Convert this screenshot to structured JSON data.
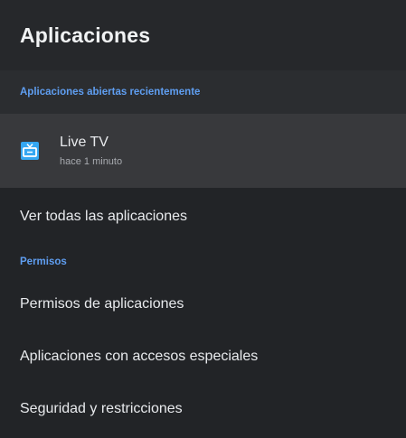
{
  "header": {
    "title": "Aplicaciones"
  },
  "recent_section": {
    "title": "Aplicaciones abiertas recientemente",
    "apps": [
      {
        "name": "Live TV",
        "time": "hace 1 minuto",
        "icon": "tv-icon"
      }
    ]
  },
  "menu": {
    "see_all": "Ver todas las aplicaciones"
  },
  "permissions_section": {
    "title": "Permisos",
    "items": [
      "Permisos de aplicaciones",
      "Aplicaciones con accesos especiales",
      "Seguridad y restricciones"
    ]
  },
  "colors": {
    "accent": "#5f9ef1",
    "icon": "#35a7f2",
    "background": "#222427",
    "selected_row": "#38393c"
  }
}
